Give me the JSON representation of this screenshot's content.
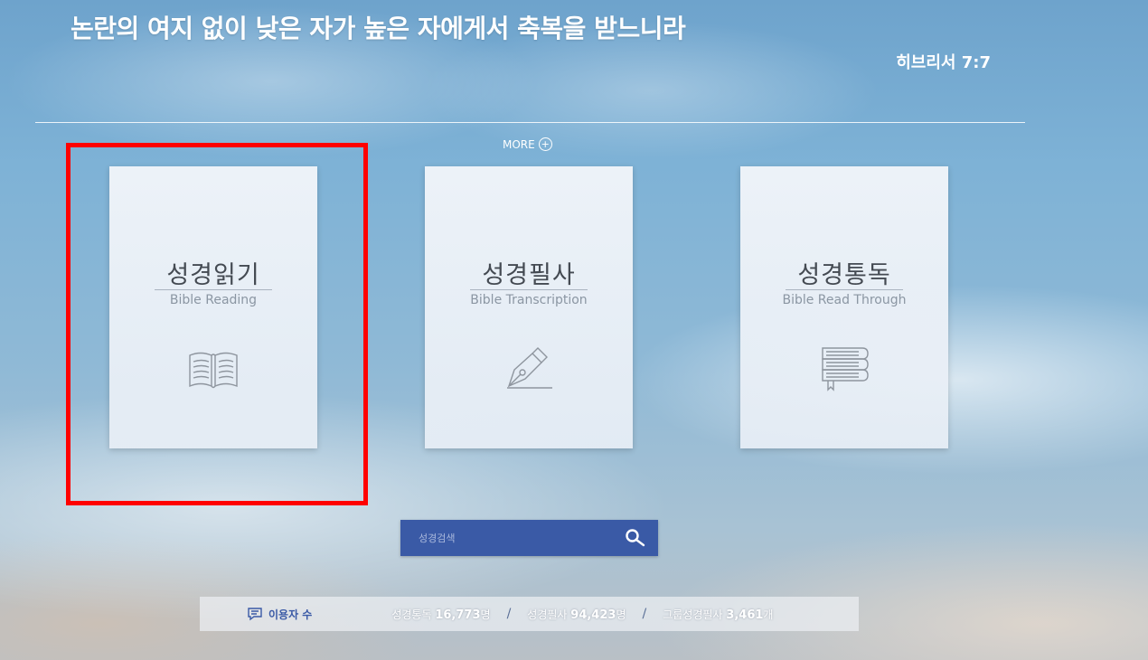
{
  "header": {
    "verse": "논란의 여지 없이 낮은 자가 높은 자에게서 축복을 받느니라",
    "reference": "히브리서 7:7"
  },
  "more": {
    "label": "MORE",
    "icon": "plus-circle-icon"
  },
  "cards": [
    {
      "title": "성경읽기",
      "subtitle": "Bible Reading",
      "icon": "open-book-icon"
    },
    {
      "title": "성경필사",
      "subtitle": "Bible Transcription",
      "icon": "fountain-pen-icon"
    },
    {
      "title": "성경통독",
      "subtitle": "Bible Read Through",
      "icon": "book-stack-icon"
    }
  ],
  "search": {
    "placeholder": "성경검색",
    "icon": "search-icon"
  },
  "stats": {
    "label": "이용자 수",
    "items": [
      {
        "name": "성경통독",
        "value": "16,773",
        "unit": "명"
      },
      {
        "name": "성경필사",
        "value": "94,423",
        "unit": "명"
      },
      {
        "name": "그룹성경필사",
        "value": "3,461",
        "unit": "개"
      }
    ],
    "separator": "/"
  },
  "colors": {
    "highlight": "#ff0000",
    "search_bg": "#3a5aa6",
    "label_blue": "#3a5aa6"
  }
}
